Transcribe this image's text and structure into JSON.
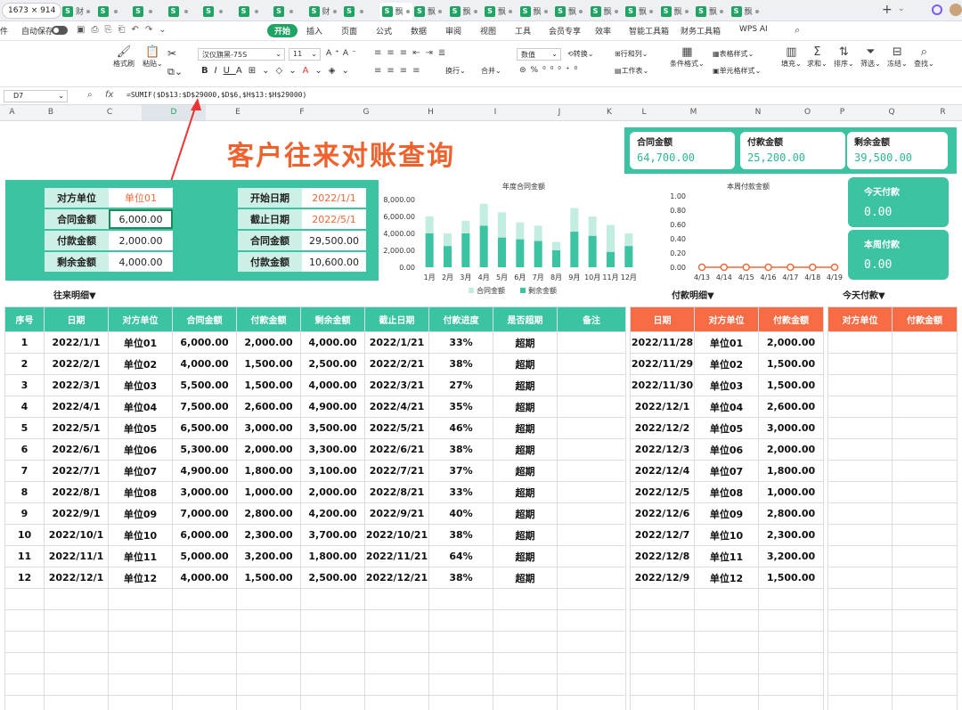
{
  "window": {
    "size_badge": "1673 × 914",
    "menu_left": "件"
  },
  "tabs": [
    {
      "label": "财"
    },
    {
      "label": ""
    },
    {
      "label": ""
    },
    {
      "label": ""
    },
    {
      "label": ""
    },
    {
      "label": ""
    },
    {
      "label": ""
    },
    {
      "label": "财"
    },
    {
      "label": ""
    },
    {
      "label": "飘"
    },
    {
      "label": "飘"
    },
    {
      "label": "飘"
    },
    {
      "label": "飘"
    },
    {
      "label": "飘"
    },
    {
      "label": "飘"
    },
    {
      "label": "飘"
    },
    {
      "label": "飘"
    },
    {
      "label": "飘"
    },
    {
      "label": "飘"
    },
    {
      "label": "飘"
    }
  ],
  "menubar": {
    "autosave": "自动保存",
    "items": [
      "开始",
      "插入",
      "页面",
      "公式",
      "数据",
      "审阅",
      "视图",
      "工具",
      "会员专享",
      "效率",
      "智能工具箱",
      "财务工具箱",
      "WPS AI"
    ]
  },
  "ribbon": {
    "format_painter": "格式刷",
    "paste": "粘贴",
    "font_name": "汉仪旗黑-75S",
    "font_size": "11",
    "wrap": "换行",
    "merge": "合并",
    "number_format": "数值",
    "convert": "转换",
    "row_col": "行和列",
    "worksheet": "工作表",
    "cond_format": "条件格式",
    "table_style": "表格样式",
    "cell_style": "单元格样式",
    "fill": "填充",
    "sum": "求和",
    "sort": "排序",
    "filter": "筛选",
    "freeze": "冻结",
    "find": "查找"
  },
  "formula_bar": {
    "cell_ref": "D7",
    "fx": "fx",
    "formula": "=SUMIF($D$13:$D$29000,$D$6,$H$13:$H$29000)"
  },
  "columns": [
    "A",
    "B",
    "C",
    "D",
    "E",
    "F",
    "G",
    "H",
    "I",
    "J",
    "K",
    "L",
    "M",
    "N",
    "O",
    "P",
    "Q",
    "R"
  ],
  "title": "客户往来对账查询",
  "summary": [
    {
      "label": "合同金额",
      "value": "64,700.00"
    },
    {
      "label": "付款金额",
      "value": "25,200.00"
    },
    {
      "label": "剩余金额",
      "value": "39,500.00"
    }
  ],
  "query_left": [
    {
      "label": "对方单位",
      "value": "单位01"
    },
    {
      "label": "合同金额",
      "value": "6,000.00"
    },
    {
      "label": "付款金额",
      "value": "2,000.00"
    },
    {
      "label": "剩余金额",
      "value": "4,000.00"
    }
  ],
  "query_right": [
    {
      "label": "开始日期",
      "value": "2022/1/1"
    },
    {
      "label": "截止日期",
      "value": "2022/5/1"
    },
    {
      "label": "合同金额",
      "value": "29,500.00"
    },
    {
      "label": "付款金额",
      "value": "10,600.00"
    }
  ],
  "side_cards": [
    {
      "label": "今天付款",
      "value": "0.00"
    },
    {
      "label": "本周付款",
      "value": "0.00"
    }
  ],
  "section_labels": {
    "detail": "往来明细▼",
    "pay_detail": "付款明细▼",
    "today_pay": "今天付款▼"
  },
  "chart_data": [
    {
      "type": "bar",
      "title": "年度合同金额",
      "categories": [
        "1月",
        "2月",
        "3月",
        "4月",
        "5月",
        "6月",
        "7月",
        "8月",
        "9月",
        "10月",
        "11月",
        "12月"
      ],
      "series": [
        {
          "name": "合同金额",
          "values": [
            6000,
            4000,
            5500,
            7500,
            6500,
            5300,
            4900,
            3000,
            7000,
            6000,
            5000,
            4000
          ],
          "color": "#c4ede1"
        },
        {
          "name": "剩余金额",
          "values": [
            4000,
            2500,
            4000,
            4900,
            3500,
            3300,
            3100,
            2000,
            4200,
            3700,
            1800,
            2500
          ],
          "color": "#3cc4a2"
        }
      ],
      "yticks": [
        "0.00",
        "2,000.00",
        "4,000.00",
        "6,000.00",
        "8,000.00"
      ],
      "ylim": [
        0,
        8000
      ]
    },
    {
      "type": "line",
      "title": "本周付款金额",
      "categories": [
        "4/13",
        "4/14",
        "4/15",
        "4/16",
        "4/17",
        "4/18",
        "4/19"
      ],
      "values": [
        0,
        0,
        0,
        0,
        0,
        0,
        0
      ],
      "yticks": [
        "0.00",
        "0.20",
        "0.40",
        "0.60",
        "0.80",
        "1.00"
      ],
      "ylim": [
        0,
        1
      ],
      "color": "#f06a3a"
    }
  ],
  "main_table": {
    "headers": [
      "序号",
      "日期",
      "对方单位",
      "合同金额",
      "付款金额",
      "剩余金额",
      "截止日期",
      "付款进度",
      "是否超期",
      "备注"
    ],
    "rows": [
      [
        "1",
        "2022/1/1",
        "单位01",
        "6,000.00",
        "2,000.00",
        "4,000.00",
        "2022/1/21",
        "33%",
        "超期",
        ""
      ],
      [
        "2",
        "2022/2/1",
        "单位02",
        "4,000.00",
        "1,500.00",
        "2,500.00",
        "2022/2/21",
        "38%",
        "超期",
        ""
      ],
      [
        "3",
        "2022/3/1",
        "单位03",
        "5,500.00",
        "1,500.00",
        "4,000.00",
        "2022/3/21",
        "27%",
        "超期",
        ""
      ],
      [
        "4",
        "2022/4/1",
        "单位04",
        "7,500.00",
        "2,600.00",
        "4,900.00",
        "2022/4/21",
        "35%",
        "超期",
        ""
      ],
      [
        "5",
        "2022/5/1",
        "单位05",
        "6,500.00",
        "3,000.00",
        "3,500.00",
        "2022/5/21",
        "46%",
        "超期",
        ""
      ],
      [
        "6",
        "2022/6/1",
        "单位06",
        "5,300.00",
        "2,000.00",
        "3,300.00",
        "2022/6/21",
        "38%",
        "超期",
        ""
      ],
      [
        "7",
        "2022/7/1",
        "单位07",
        "4,900.00",
        "1,800.00",
        "3,100.00",
        "2022/7/21",
        "37%",
        "超期",
        ""
      ],
      [
        "8",
        "2022/8/1",
        "单位08",
        "3,000.00",
        "1,000.00",
        "2,000.00",
        "2022/8/21",
        "33%",
        "超期",
        ""
      ],
      [
        "9",
        "2022/9/1",
        "单位09",
        "7,000.00",
        "2,800.00",
        "4,200.00",
        "2022/9/21",
        "40%",
        "超期",
        ""
      ],
      [
        "10",
        "2022/10/1",
        "单位10",
        "6,000.00",
        "2,300.00",
        "3,700.00",
        "2022/10/21",
        "38%",
        "超期",
        ""
      ],
      [
        "11",
        "2022/11/1",
        "单位11",
        "5,000.00",
        "3,200.00",
        "1,800.00",
        "2022/11/21",
        "64%",
        "超期",
        ""
      ],
      [
        "12",
        "2022/12/1",
        "单位12",
        "4,000.00",
        "1,500.00",
        "2,500.00",
        "2022/12/21",
        "38%",
        "超期",
        ""
      ]
    ]
  },
  "pay_table": {
    "headers": [
      "日期",
      "对方单位",
      "付款金额"
    ],
    "rows": [
      [
        "2022/11/28",
        "单位01",
        "2,000.00"
      ],
      [
        "2022/11/29",
        "单位02",
        "1,500.00"
      ],
      [
        "2022/11/30",
        "单位03",
        "1,500.00"
      ],
      [
        "2022/12/1",
        "单位04",
        "2,600.00"
      ],
      [
        "2022/12/2",
        "单位05",
        "3,000.00"
      ],
      [
        "2022/12/3",
        "单位06",
        "2,000.00"
      ],
      [
        "2022/12/4",
        "单位07",
        "1,800.00"
      ],
      [
        "2022/12/5",
        "单位08",
        "1,000.00"
      ],
      [
        "2022/12/6",
        "单位09",
        "2,800.00"
      ],
      [
        "2022/12/7",
        "单位10",
        "2,300.00"
      ],
      [
        "2022/12/8",
        "单位11",
        "3,200.00"
      ],
      [
        "2022/12/9",
        "单位12",
        "1,500.00"
      ]
    ]
  },
  "today_table": {
    "headers": [
      "对方单位",
      "付款金额"
    ]
  }
}
